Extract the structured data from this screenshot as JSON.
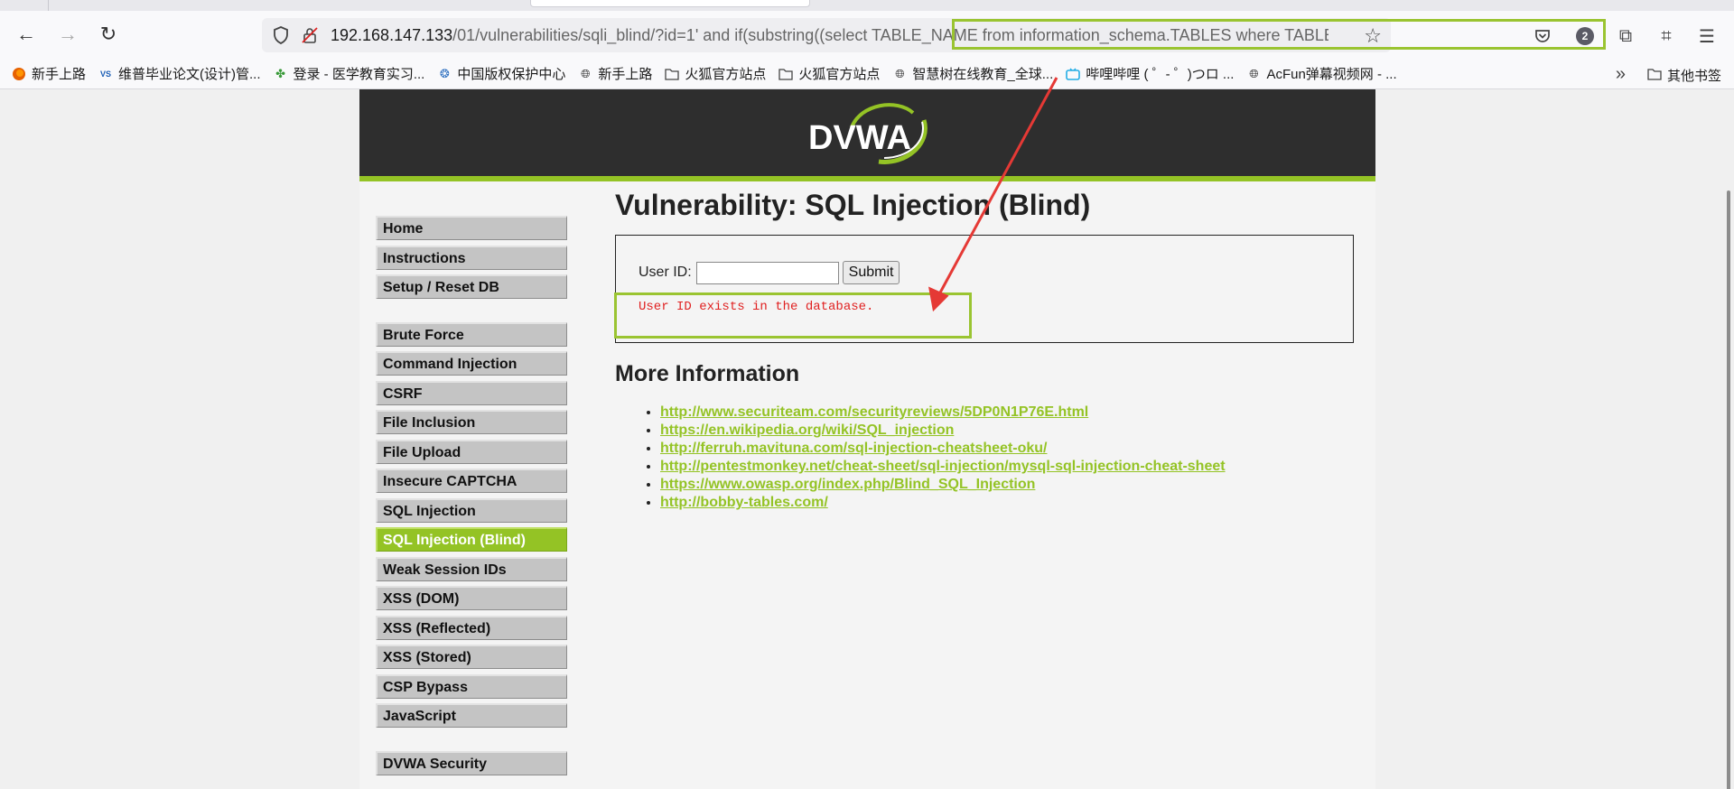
{
  "browser": {
    "url_host": "192.168.147.133",
    "url_path": "/01/vulnerabilities/sqli_blind/?id=1' and if(substring((select TABLE_NAME from information_schema.TABLES where TABLE_",
    "notification_count": "2"
  },
  "bookmarks": [
    {
      "label": "新手上路",
      "icon": "firefox-icon"
    },
    {
      "label": "维普毕业论文(设计)管...",
      "icon": "vip-icon"
    },
    {
      "label": "登录 - 医学教育实习...",
      "icon": "leaf-icon"
    },
    {
      "label": "中国版权保护中心",
      "icon": "brain-icon"
    },
    {
      "label": "新手上路",
      "icon": "globe-icon"
    },
    {
      "label": "火狐官方站点",
      "icon": "folder-icon"
    },
    {
      "label": "火狐官方站点",
      "icon": "folder-icon"
    },
    {
      "label": "智慧树在线教育_全球...",
      "icon": "globe-icon"
    },
    {
      "label": "哔哩哔哩 ( ゜- ゜)つロ ...",
      "icon": "tv-icon"
    },
    {
      "label": "AcFun弹幕视频网 - ...",
      "icon": "globe-icon"
    }
  ],
  "bookmarks_other": "其他书签",
  "dvwa": {
    "logo_text": "DVWA",
    "menu_group1": [
      "Home",
      "Instructions",
      "Setup / Reset DB"
    ],
    "menu_group2": [
      "Brute Force",
      "Command Injection",
      "CSRF",
      "File Inclusion",
      "File Upload",
      "Insecure CAPTCHA",
      "SQL Injection",
      "SQL Injection (Blind)",
      "Weak Session IDs",
      "XSS (DOM)",
      "XSS (Reflected)",
      "XSS (Stored)",
      "CSP Bypass",
      "JavaScript"
    ],
    "menu_group3": [
      "DVWA Security"
    ],
    "active_item": "SQL Injection (Blind)",
    "page_title": "Vulnerability: SQL Injection (Blind)",
    "form": {
      "label": "User ID:",
      "value": "",
      "submit": "Submit"
    },
    "result_message": "User ID exists in the database.",
    "more_info_title": "More Information",
    "links": [
      "http://www.securiteam.com/securityreviews/5DP0N1P76E.html",
      "https://en.wikipedia.org/wiki/SQL_injection",
      "http://ferruh.mavituna.com/sql-injection-cheatsheet-oku/",
      "http://pentestmonkey.net/cheat-sheet/sql-injection/mysql-sql-injection-cheat-sheet",
      "https://www.owasp.org/index.php/Blind_SQL_Injection",
      "http://bobby-tables.com/"
    ]
  },
  "colors": {
    "accent": "#94c325",
    "highlight": "#9ac431",
    "arrow": "#e53935",
    "error": "#e02020"
  }
}
